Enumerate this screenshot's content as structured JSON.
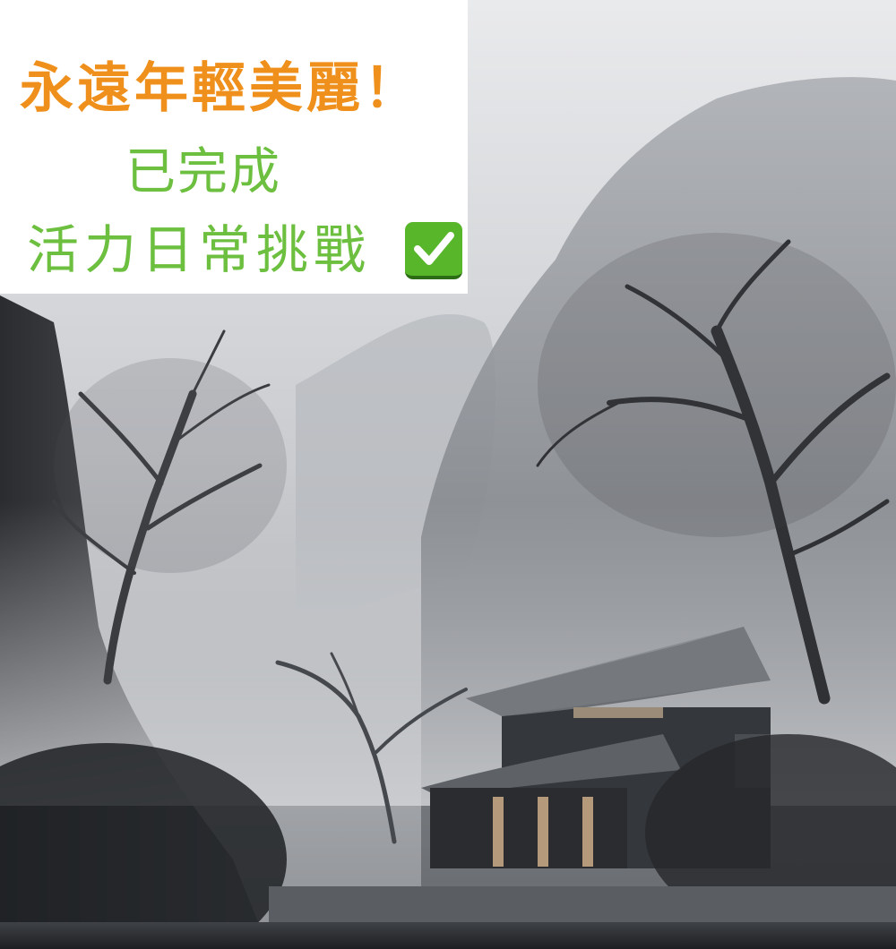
{
  "caption": {
    "title": "永遠年輕美麗！",
    "line2": "已完成",
    "line3": "活力日常挑戰"
  },
  "colors": {
    "title": "#f0901c",
    "subtitle": "#6cbf3f",
    "check_bg": "#58b62a"
  },
  "icons": {
    "check": "check-mark-button-icon"
  }
}
